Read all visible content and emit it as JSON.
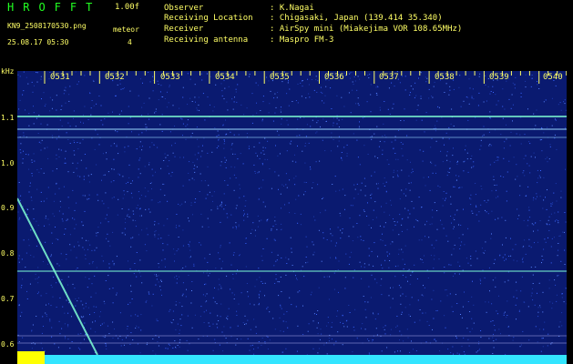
{
  "header": {
    "app_title": "HROFFT",
    "version": "1.00f",
    "filename": "KN9_2508170530.png",
    "mode": "meteor",
    "count": "4",
    "datetime": "25.08.17 05:30"
  },
  "info": [
    {
      "key": "Observer",
      "value": ": K.Nagai"
    },
    {
      "key": "Receiving Location",
      "value": ": Chigasaki, Japan (139.414 35.340)"
    },
    {
      "key": "Receiver",
      "value": ": AirSpy mini (Miakejima VOR 108.65MHz)"
    },
    {
      "key": "Receiving antenna",
      "value": ": Maspro FM-3"
    }
  ],
  "axis": {
    "y_unit": "kHz",
    "y_ticks": [
      "1.1",
      "1.0",
      "0.9",
      "0.8",
      "0.7",
      "0.6"
    ],
    "x_ticks": [
      "0531",
      "0532",
      "0533",
      "0534",
      "0535",
      "0536",
      "0537",
      "0538",
      "0539",
      "0540"
    ]
  },
  "colors": {
    "background": "#0a1a70",
    "trace": "#7fffd4",
    "text": "#ffff66"
  }
}
